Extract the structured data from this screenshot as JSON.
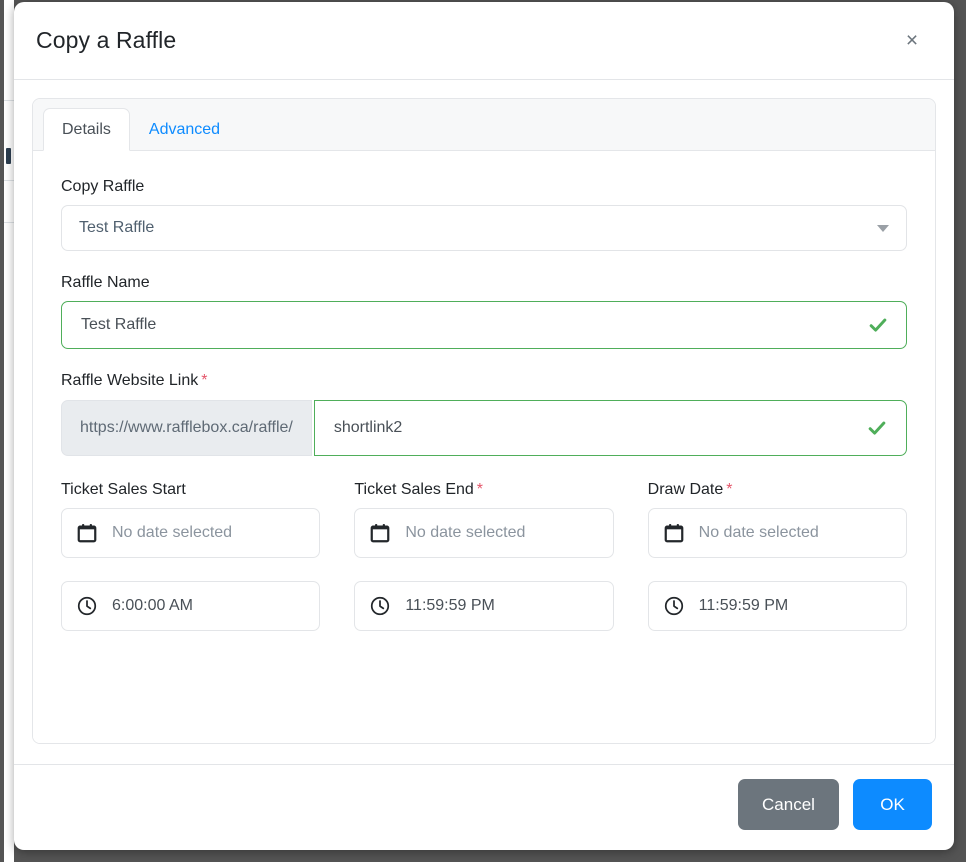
{
  "modal": {
    "title": "Copy a Raffle",
    "close_icon": "close-icon",
    "close_label": "×"
  },
  "tabs": [
    {
      "label": "Details",
      "active": true
    },
    {
      "label": "Advanced",
      "active": false
    }
  ],
  "form": {
    "copy_raffle": {
      "label": "Copy Raffle",
      "value": "Test Raffle",
      "icon": "chevron-down-icon"
    },
    "raffle_name": {
      "label": "Raffle Name",
      "value": "Test Raffle",
      "valid": true,
      "icon": "check-icon"
    },
    "raffle_website_link": {
      "label": "Raffle Website Link",
      "required_marker": "*",
      "prefix": "https://www.rafflebox.ca/raffle/",
      "value": "shortlink2",
      "valid": true,
      "icon": "check-icon"
    },
    "ticket_sales_start": {
      "label": "Ticket Sales Start",
      "required_marker": "",
      "date_placeholder": "No date selected",
      "date_icon": "calendar-icon",
      "time_value": "6:00:00 AM",
      "time_icon": "clock-icon"
    },
    "ticket_sales_end": {
      "label": "Ticket Sales End",
      "required_marker": "*",
      "date_placeholder": "No date selected",
      "date_icon": "calendar-icon",
      "time_value": "11:59:59 PM",
      "time_icon": "clock-icon"
    },
    "draw_date": {
      "label": "Draw Date",
      "required_marker": "*",
      "date_placeholder": "No date selected",
      "date_icon": "calendar-icon",
      "time_value": "11:59:59 PM",
      "time_icon": "clock-icon"
    }
  },
  "footer": {
    "cancel_label": "Cancel",
    "ok_label": "OK"
  },
  "colors": {
    "primary": "#0d8bff",
    "secondary": "#6c757d",
    "valid": "#4fae5a",
    "required": "#e4556a",
    "tab_link": "#0d8bff",
    "addon_bg": "#e9ecef",
    "backdrop": "#545454"
  }
}
